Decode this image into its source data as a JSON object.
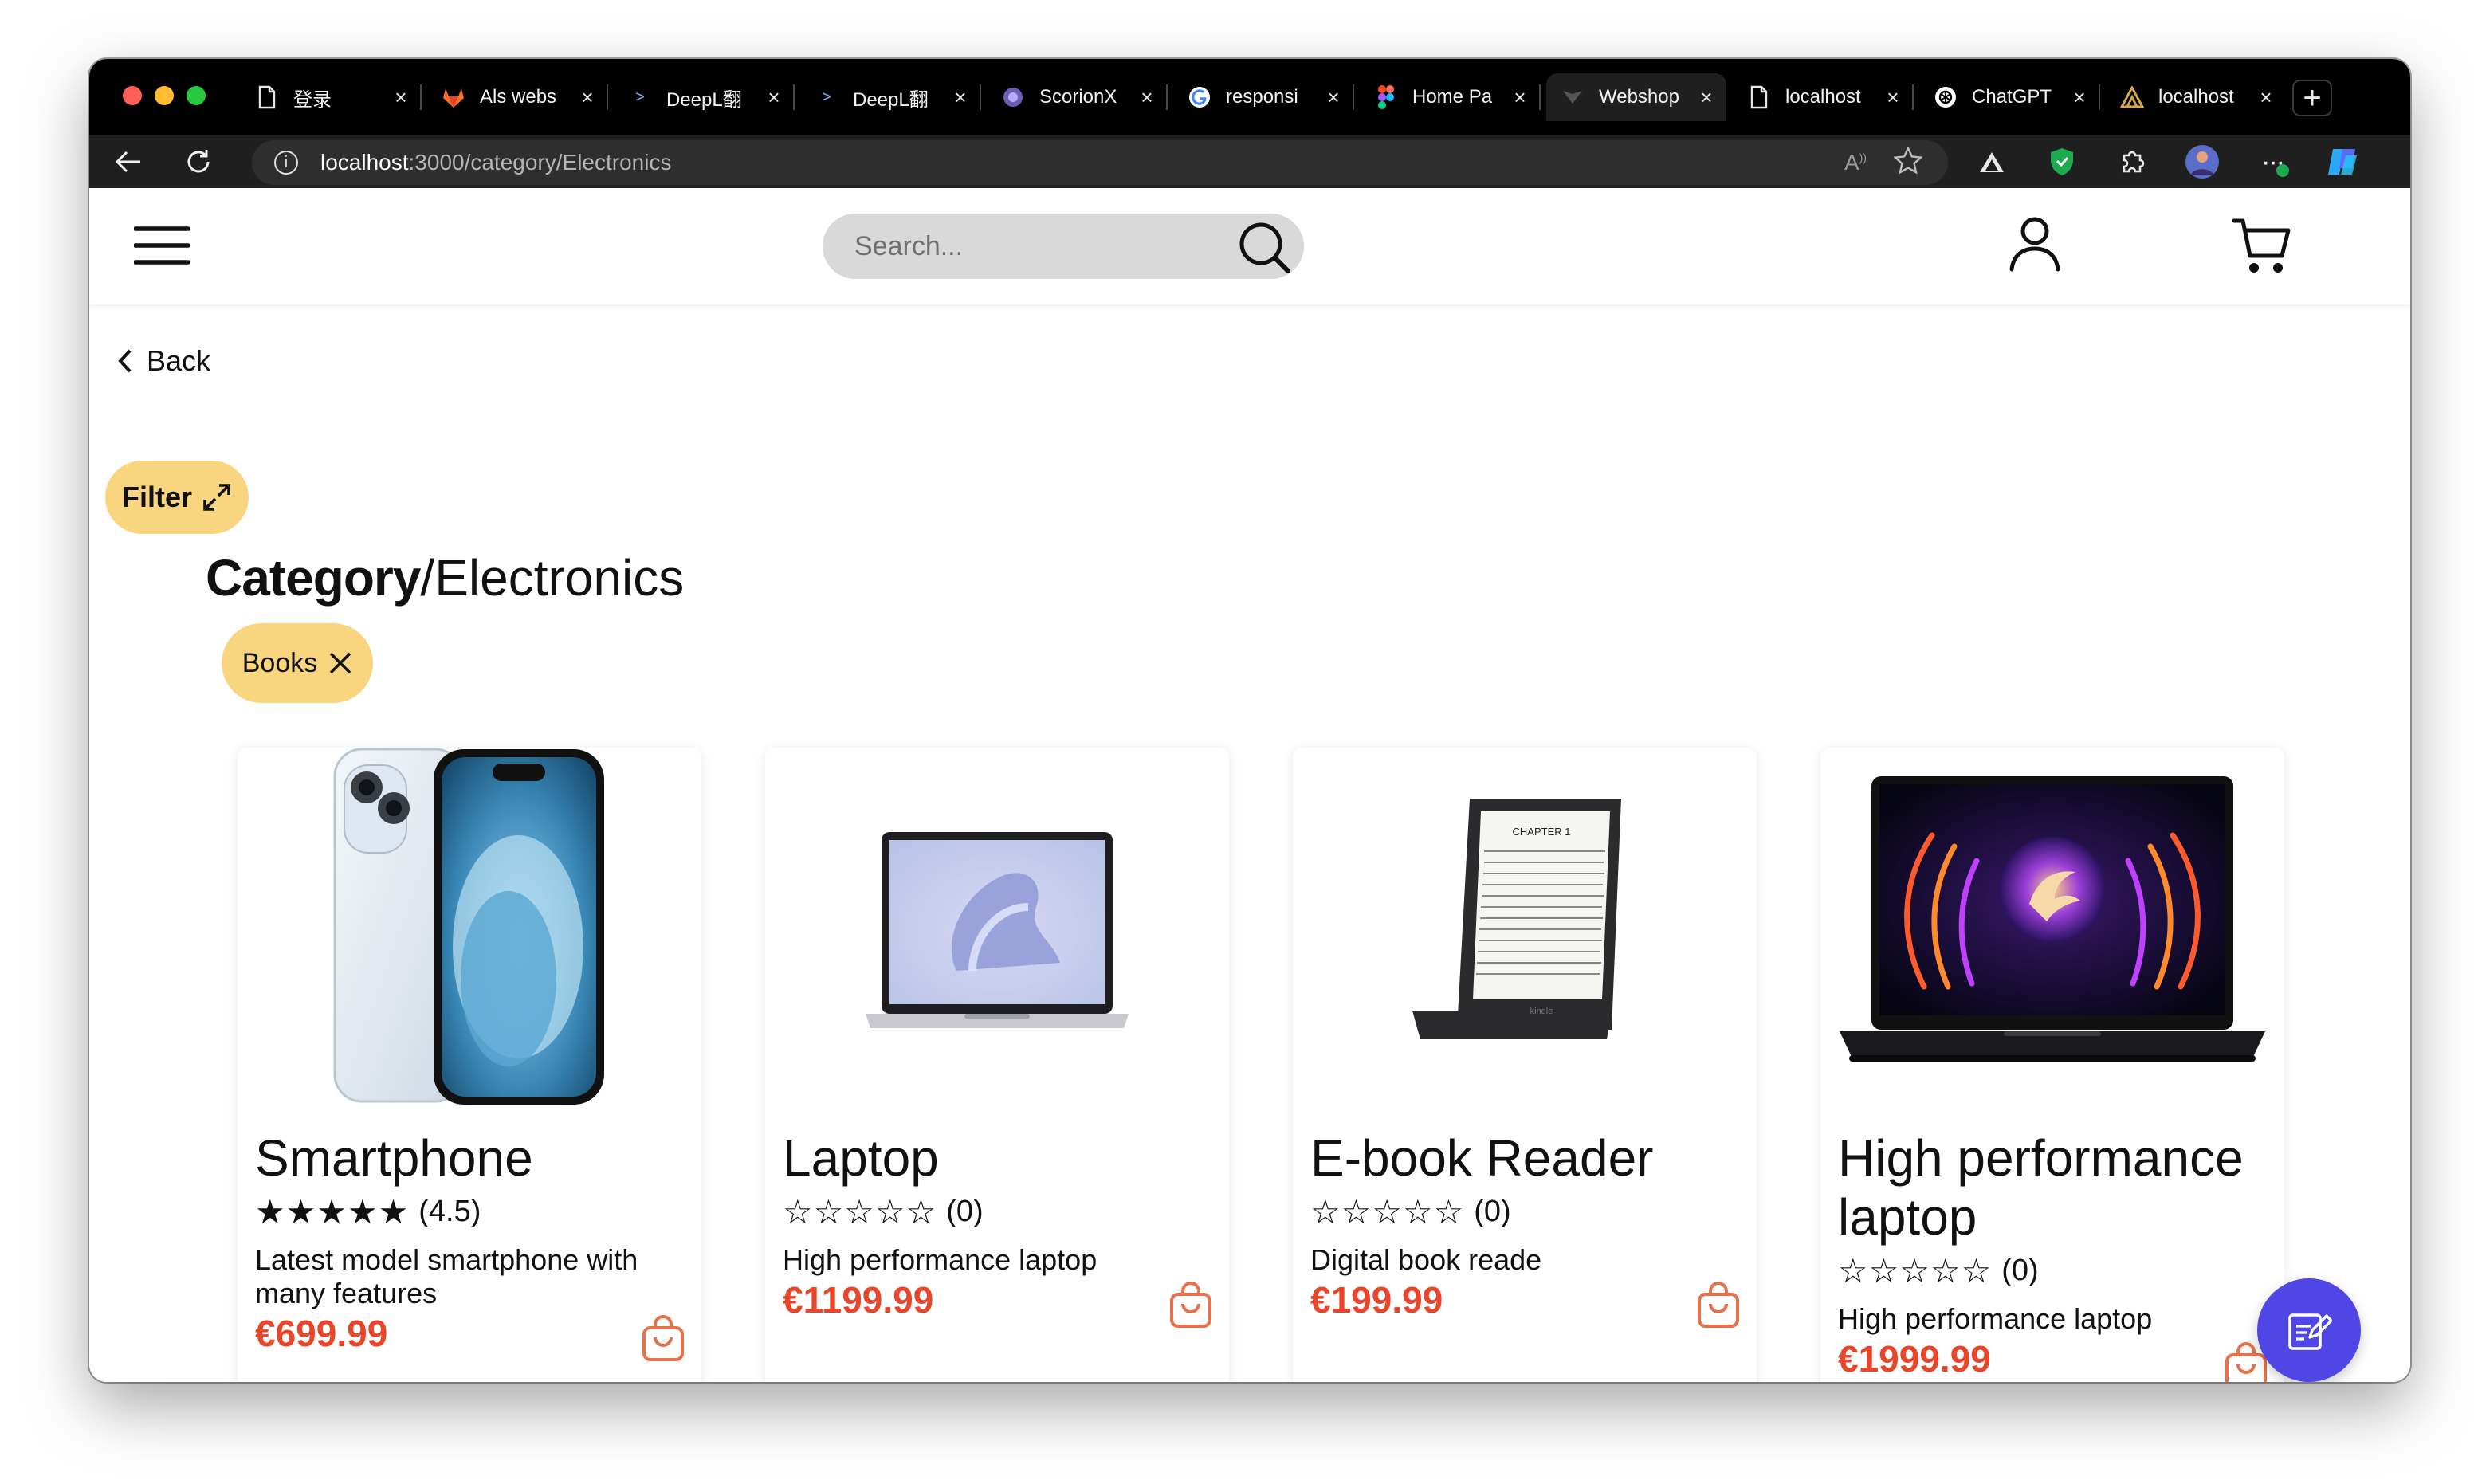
{
  "browser": {
    "tabs": [
      {
        "label": "登录",
        "icon": "document-icon"
      },
      {
        "label": "Als webs",
        "icon": "gitlab-icon"
      },
      {
        "label": "DeepL翻",
        "icon": "deepl-icon"
      },
      {
        "label": "DeepL翻",
        "icon": "deepl-icon"
      },
      {
        "label": "ScorionX",
        "icon": "scorion-icon"
      },
      {
        "label": "responsi",
        "icon": "google-icon"
      },
      {
        "label": "Home Pa",
        "icon": "figma-icon"
      },
      {
        "label": "Webshop",
        "icon": "webshop-icon"
      },
      {
        "label": "localhost",
        "icon": "document-icon"
      },
      {
        "label": "ChatGPT",
        "icon": "chatgpt-icon"
      },
      {
        "label": "localhost",
        "icon": "localhost-icon"
      }
    ],
    "active_tab": 7,
    "url_host": "localhost",
    "url_path": ":3000/category/Electronics"
  },
  "header": {
    "search_placeholder": "Search..."
  },
  "page": {
    "back_label": "Back",
    "filter_label": "Filter",
    "heading_strong": "Category",
    "heading_rest": "/Electronics",
    "chip_label": "Books"
  },
  "products": [
    {
      "name": "Smartphone",
      "stars": "★★★★★",
      "rating": "(4.5)",
      "description": "Latest model smartphone with many features",
      "price": "€699.99",
      "image": "smartphone-image"
    },
    {
      "name": "Laptop",
      "stars": "☆☆☆☆☆",
      "rating": "(0)",
      "description": "High performance laptop",
      "price": "€1199.99",
      "image": "laptop-image"
    },
    {
      "name": "E-book Reader",
      "stars": "☆☆☆☆☆",
      "rating": "(0)",
      "description": "Digital book reade",
      "price": "€199.99",
      "image": "ebook-reader-image"
    },
    {
      "name": "High performance laptop",
      "stars": "☆☆☆☆☆",
      "rating": "(0)",
      "description": "High performance laptop",
      "price": "€1999.99",
      "image": "gaming-laptop-image"
    }
  ],
  "colors": {
    "accent_yellow": "#f9d57f",
    "price_red": "#e8452a",
    "fab_purple": "#4f46e5"
  }
}
